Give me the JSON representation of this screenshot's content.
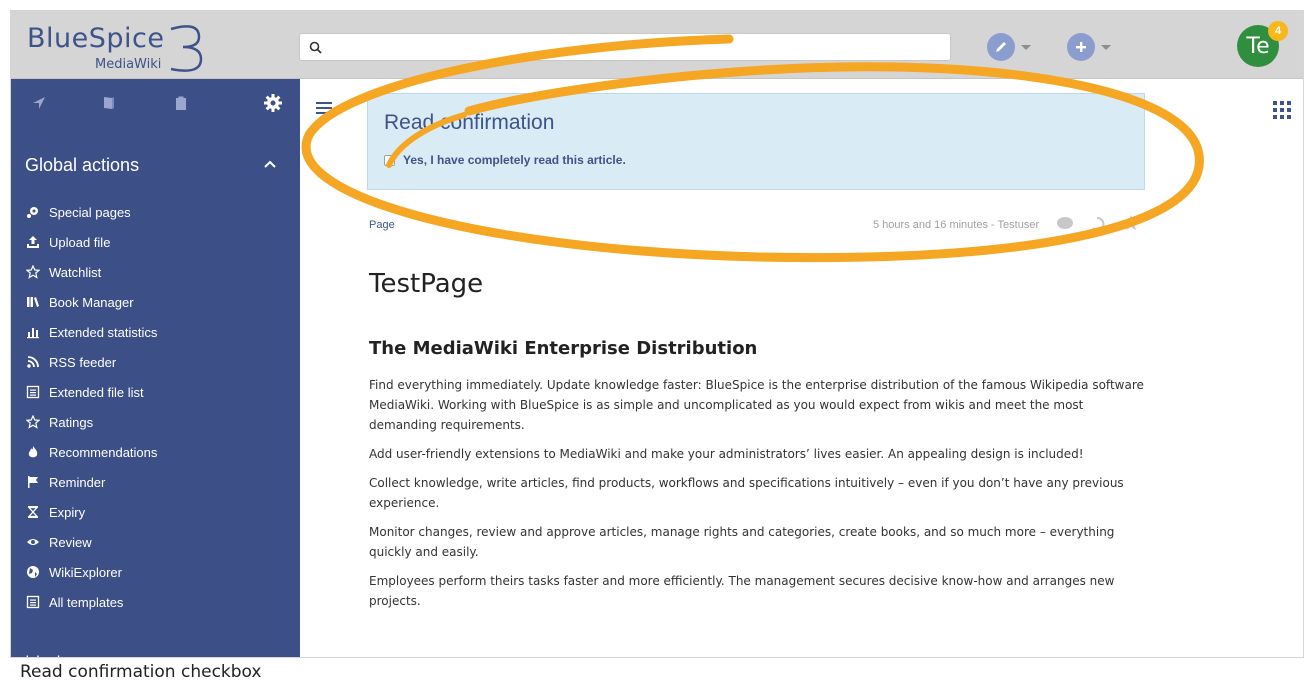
{
  "header": {
    "logo_text": "BlueSpice",
    "logo_sub": "MediaWiki",
    "search_placeholder": "",
    "notification_count": "4",
    "avatar_initials": "Te"
  },
  "sidebar": {
    "tabs": [
      "navigation-icon",
      "book-icon",
      "clipboard-icon",
      "gear-icon"
    ],
    "section_title": "Global actions",
    "items": [
      {
        "label": "Special pages",
        "icon": "special-pages-icon"
      },
      {
        "label": "Upload file",
        "icon": "upload-icon"
      },
      {
        "label": "Watchlist",
        "icon": "star-outline-icon"
      },
      {
        "label": "Book Manager",
        "icon": "books-icon"
      },
      {
        "label": "Extended statistics",
        "icon": "bar-chart-icon"
      },
      {
        "label": "RSS feeder",
        "icon": "rss-icon"
      },
      {
        "label": "Extended file list",
        "icon": "list-icon"
      },
      {
        "label": "Ratings",
        "icon": "star-outline-icon"
      },
      {
        "label": "Recommendations",
        "icon": "flame-icon"
      },
      {
        "label": "Reminder",
        "icon": "flag-icon"
      },
      {
        "label": "Expiry",
        "icon": "hourglass-icon"
      },
      {
        "label": "Review",
        "icon": "eye-icon"
      },
      {
        "label": "WikiExplorer",
        "icon": "globe-icon"
      },
      {
        "label": "All templates",
        "icon": "list-icon"
      }
    ]
  },
  "read_confirmation": {
    "title": "Read confirmation",
    "checkbox_label": "Yes, I have completely read this article."
  },
  "page": {
    "breadcrumb": "Page",
    "meta": "5 hours and 16 minutes - Testuser",
    "title": "TestPage",
    "heading": "The MediaWiki Enterprise Distribution",
    "paragraphs": [
      "Find everything immediately. Update knowledge faster: BlueSpice is the enterprise distribution of the famous Wikipedia software MediaWiki. Working with BlueSpice is as simple and uncomplicated as you would expect from wikis and meet the most demanding requirements.",
      "Add user-friendly extensions to MediaWiki and make your administrators’ lives easier. An appealing design is included!",
      "Collect knowledge, write articles, find products, workflows and specifications intuitively – even if you don’t have any previous experience.",
      "Monitor changes, review and approve articles, manage rights and categories, create books, and so much more – everything quickly and easily.",
      "Employees perform theirs tasks faster and more efficiently. The management secures decisive know-how and arranges new projects."
    ]
  },
  "caption": "Read confirmation checkbox",
  "colors": {
    "sidebar_bg": "#3d4f87",
    "brand": "#3e5389",
    "highlight": "#f5a623",
    "confirm_bg": "#d9ebf5"
  }
}
